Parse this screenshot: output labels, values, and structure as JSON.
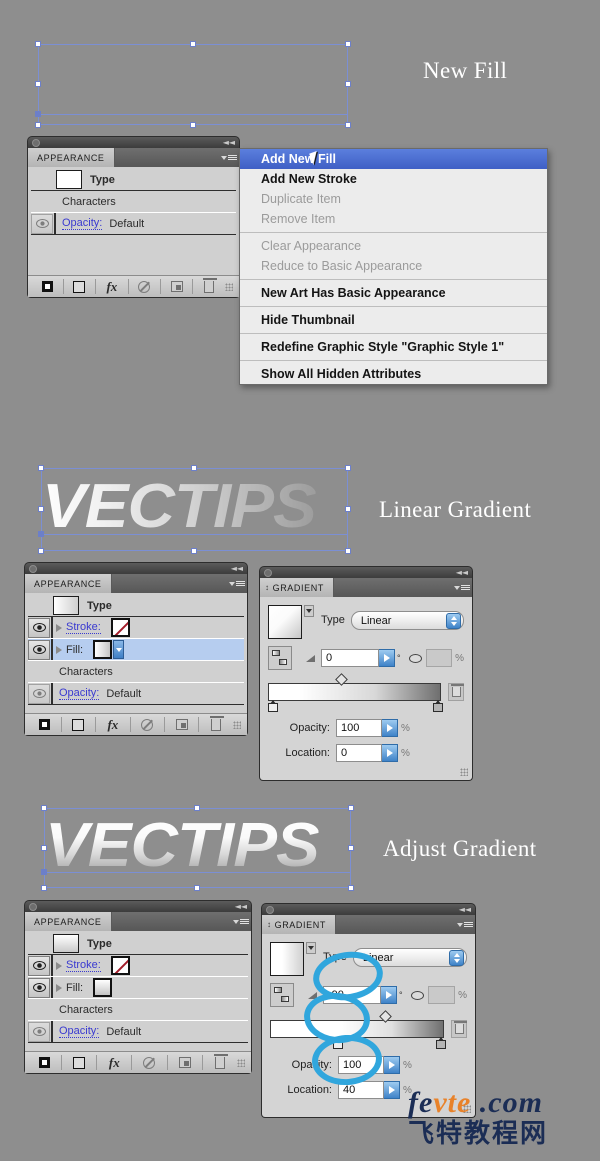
{
  "meta": {
    "bg_color": "#8e8e8e",
    "accent_blue": "#3f5fc5",
    "annotation_color": "#30a6dd"
  },
  "steps": [
    {
      "label": "New Fill"
    },
    {
      "label": "Linear Gradient"
    },
    {
      "label": "Adjust Gradient"
    }
  ],
  "wordmark": {
    "text": "VECTIPS"
  },
  "context_menu": {
    "items": [
      {
        "label": "Add New Fill",
        "state": "highlighted"
      },
      {
        "label": "Add New Stroke",
        "state": "bold"
      },
      {
        "label": "Duplicate Item",
        "state": "disabled"
      },
      {
        "label": "Remove Item",
        "state": "disabled"
      },
      {
        "label": "Clear Appearance",
        "state": "disabled"
      },
      {
        "label": "Reduce to Basic Appearance",
        "state": "disabled"
      },
      {
        "label": "New Art Has Basic Appearance",
        "state": "bold"
      },
      {
        "label": "Hide Thumbnail",
        "state": "bold"
      },
      {
        "label": "Redefine Graphic Style \"Graphic Style 1\"",
        "state": "bold"
      },
      {
        "label": "Show All Hidden Attributes",
        "state": "bold"
      }
    ]
  },
  "appearance_panel_1": {
    "tab_label": "APPEARANCE",
    "rows": [
      {
        "label": "Type"
      },
      {
        "label": "Characters"
      },
      {
        "label": "Opacity:",
        "value": "Default"
      }
    ]
  },
  "appearance_panel_2": {
    "tab_label": "APPEARANCE",
    "rows": [
      {
        "label": "Type"
      },
      {
        "label": "Stroke:"
      },
      {
        "label": "Fill:"
      },
      {
        "label": "Characters"
      },
      {
        "label": "Opacity:",
        "value": "Default"
      }
    ]
  },
  "appearance_panel_3": {
    "tab_label": "APPEARANCE",
    "rows": [
      {
        "label": "Type"
      },
      {
        "label": "Stroke:"
      },
      {
        "label": "Fill:"
      },
      {
        "label": "Characters"
      },
      {
        "label": "Opacity:",
        "value": "Default"
      }
    ]
  },
  "gradient_panel_1": {
    "tab_label": "GRADIENT",
    "type_label": "Type",
    "type_value": "Linear",
    "angle_value": "0",
    "degree_symbol": "°",
    "aspect_value": "",
    "percent_symbol": "%",
    "opacity_label": "Opacity:",
    "opacity_value": "100",
    "location_label": "Location:",
    "location_value": "0"
  },
  "gradient_panel_2": {
    "tab_label": "GRADIENT",
    "type_label": "Type",
    "type_value": "Linear",
    "angle_value": "-90",
    "degree_symbol": "°",
    "aspect_value": "",
    "percent_symbol": "%",
    "opacity_label": "Opacity:",
    "opacity_value": "100",
    "location_label": "Location:",
    "location_value": "40"
  },
  "watermark": {
    "brand_fe": "fe",
    "brand_vte": "vte",
    "brand_dotcom": " .com",
    "chinese": "飞特教程网"
  }
}
